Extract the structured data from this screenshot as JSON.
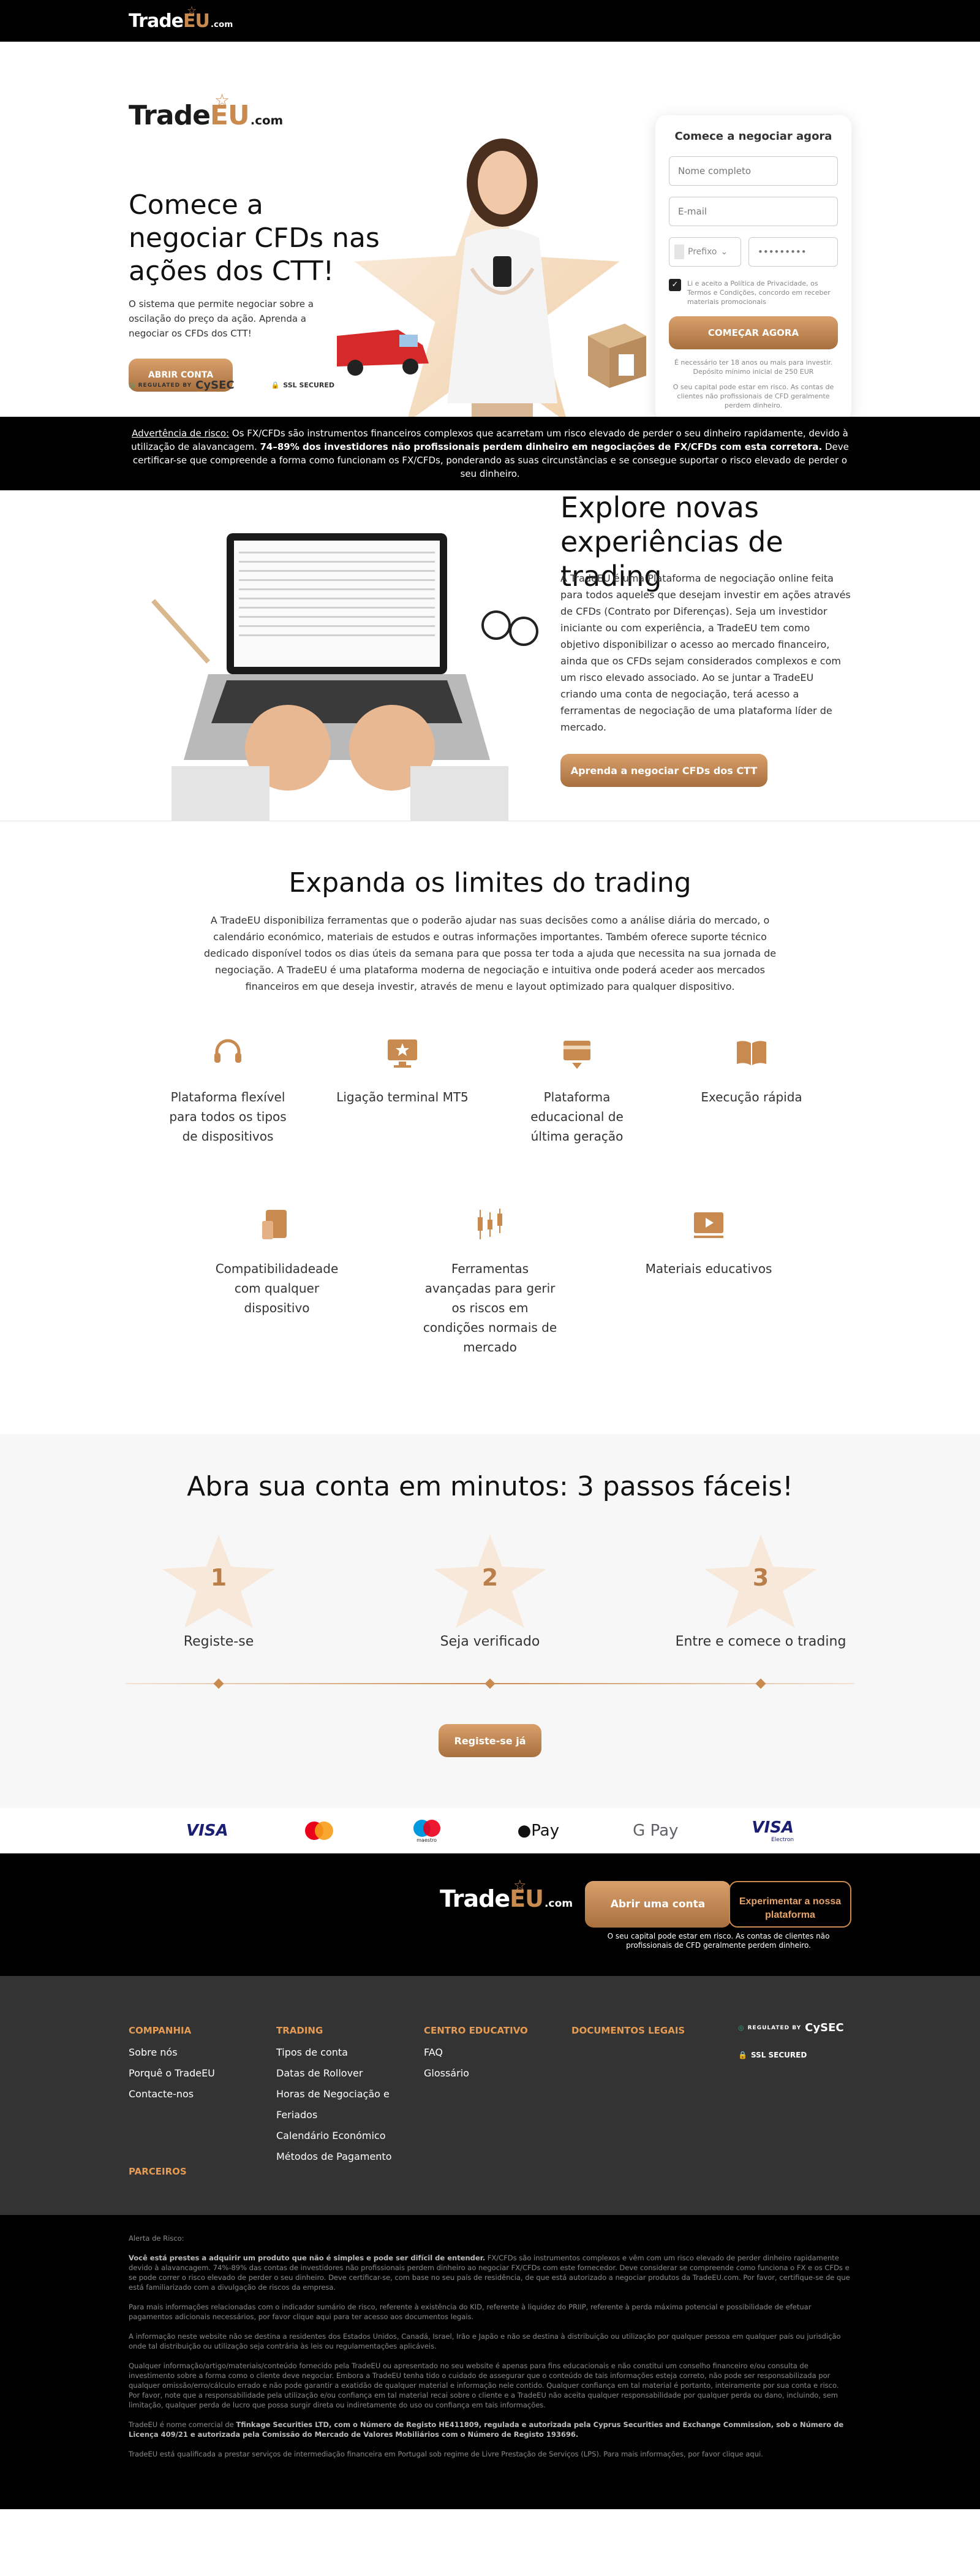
{
  "brand": {
    "name_a": "Trade",
    "name_b": "EU",
    "name_c": ".com"
  },
  "hero": {
    "title": "Comece a negociar CFDs nas ações dos CTT!",
    "description": "O sistema que permite negociar sobre a oscilação do preço da ação. Aprenda a negociar os CFDs dos CTT!",
    "cta": "ABRIR CONTA",
    "regulated": "REGULATED BY",
    "cysec": "CySEC",
    "ssl": "SSL SECURED"
  },
  "form": {
    "title": "Comece a negociar agora",
    "name_placeholder": "Nome completo",
    "email_placeholder": "E-mail",
    "prefix": "Prefixo",
    "phone_placeholder": "•••••••••",
    "consent": "Li e aceito a Política de Privacidade, os Termos e Condições, concordo em receber materiais promocionais",
    "submit": "COMEÇAR AGORA",
    "note1": "É necessário ter 18 anos ou mais para investir. Depósito mínimo inicial de 250 EUR",
    "note2": "O seu capital pode estar em risco. As contas de clientes não profissionais de CFD geralmente perdem dinheiro."
  },
  "risk": {
    "label": "Advertência de risco:",
    "text1": " Os FX/CFDs são instrumentos financeiros complexos que acarretam um risco elevado de perder o seu dinheiro rapidamente, devido à utilização de alavancagem. ",
    "bold": "74–89% dos investidores não profissionais perdem dinheiro em negociações de FX/CFDs com esta corretora.",
    "text2": " Deve certificar-se que compreende a forma como funcionam os FX/CFDs, ponderando as suas circunstâncias e se consegue suportar o risco elevado de perder o seu dinheiro."
  },
  "explore": {
    "title": "Explore novas experiências de trading",
    "description": "A TradeEU é uma Plataforma de negociação online feita para todos aqueles que desejam investir em ações através de CFDs (Contrato por Diferenças). Seja um investidor iniciante ou com experiência, a TradeEU tem como objetivo disponibilizar o acesso ao mercado financeiro, ainda que os CFDs sejam considerados complexos e com um risco elevado associado. Ao se juntar a TradeEU criando uma conta de negociação, terá acesso a ferramentas de negociação de uma plataforma líder de mercado.",
    "cta": "Aprenda a negociar CFDs dos CTT"
  },
  "expand": {
    "title": "Expanda os limites do trading",
    "description": "A TradeEU disponibiliza ferramentas que o poderão ajudar nas suas decisões como a análise diária do mercado, o calendário económico, materiais de estudos e outras informações importantes. Também oferece suporte técnico dedicado disponível todos os dias úteis da semana para que possa ter toda a ajuda que necessita na sua jornada de negociação. A TradeEU é uma plataforma moderna de negociação e intuitiva onde poderá aceder aos mercados financeiros em que deseja investir, através de menu e layout optimizado para qualquer dispositivo.",
    "features": [
      {
        "label": "Plataforma flexível para todos os tipos de dispositivos",
        "icon": "headset-icon"
      },
      {
        "label": "Ligação terminal MT5",
        "icon": "monitor-star-icon"
      },
      {
        "label": "Plataforma educacional de última geração",
        "icon": "education-icon"
      },
      {
        "label": "Execução rápida",
        "icon": "book-icon"
      },
      {
        "label": "Compatibilidadeade com qualquer dispositivo",
        "icon": "devices-icon"
      },
      {
        "label": "Ferramentas avançadas para gerir os riscos em condições normais de mercado",
        "icon": "candlestick-icon"
      },
      {
        "label": "Materiais educativos",
        "icon": "video-icon"
      }
    ]
  },
  "steps": {
    "title": "Abra sua conta em minutos: 3 passos fáceis!",
    "items": [
      {
        "num": "1",
        "label": "Registe-se"
      },
      {
        "num": "2",
        "label": "Seja verificado"
      },
      {
        "num": "3",
        "label": "Entre e comece o trading"
      }
    ],
    "cta": "Registe-se já"
  },
  "payments": {
    "visa": "VISA",
    "applepay": "Pay",
    "gpay": "G Pay",
    "visa2": "VISA",
    "electron": "Electron",
    "maestro": "maestro"
  },
  "footer_cta": {
    "btn1": "Abrir uma conta",
    "btn2": "Experimentar a nossa plataforma",
    "note": "O seu capital pode estar em risco. As contas de clientes não profissionais de CFD geralmente perdem dinheiro."
  },
  "footer": {
    "cols": [
      {
        "title": "COMPANHIA",
        "links": [
          "Sobre nós",
          "Porquê o TradeEU",
          "Contacte-nos"
        ]
      },
      {
        "title": "TRADING",
        "links": [
          "Tipos de conta",
          "Datas de Rollover",
          "Horas de Negociação e Feriados",
          "Calendário Económico",
          "Métodos de Pagamento"
        ]
      },
      {
        "title": "CENTRO EDUCATIVO",
        "links": [
          "FAQ",
          "Glossário"
        ]
      },
      {
        "title": "DOCUMENTOS LEGAIS",
        "links": []
      }
    ],
    "partners": "PARCEIROS",
    "regulated": "REGULATED BY",
    "cysec": "CySEC",
    "ssl": "SSL SECURED"
  },
  "legal": {
    "heading": "Alerta de Risco:",
    "p1_bold": "Você está prestes a adquirir um produto que não é simples e pode ser difícil de entender.",
    "p1": " FX/CFDs são instrumentos complexos e vêm com um risco elevado de perder dinheiro rapidamente devido à alavancagem. 74%-89% das contas de investidores não profissionais perdem dinheiro ao negociar FX/CFDs com este fornecedor. Deve considerar se compreende como funciona o FX e os CFDs e se pode correr o risco elevado de perder o seu dinheiro. Deve certificar-se, com base no seu país de residência, de que está autorizado a negociar produtos da TradeEU.com. Por favor, certifique-se de que está familiarizado com a divulgação de riscos da empresa.",
    "p2": "Para mais informações relacionadas com o indicador sumário de risco, referente à existência do KID, referente à liquidez do PRIIP, referente à perda máxima potencial e possibilidade de efetuar pagamentos adicionais necessários, por favor clique aqui para ter acesso aos documentos legais.",
    "p3": "A informação neste website não se destina a residentes dos Estados Unidos, Canadá, Israel, Irão e Japão e não se destina à distribuição ou utilização por qualquer pessoa em qualquer país ou jurisdição onde tal distribuição ou utilização seja contrária às leis ou regulamentações aplicáveis.",
    "p4": "Qualquer informação/artigo/materiais/conteúdo fornecido pela TradeEU ou apresentado no seu website é apenas para fins educacionais e não constitui um conselho financeiro e/ou consulta de investimento sobre a forma como o cliente deve negociar. Embora a TradeEU tenha tido o cuidado de assegurar que o conteúdo de tais informações esteja correto, não pode ser responsabilizada por qualquer omissão/erro/cálculo errado e não pode garantir a exatidão de qualquer material e informação nele contido. Qualquer confiança em tal material é portanto, inteiramente por sua conta e risco. Por favor, note que a responsabilidade pela utilização e/ou confiança em tal material recai sobre o cliente e a TradeEU não aceita qualquer responsabilidade por qualquer perda ou dano, incluindo, sem limitação, qualquer perda de lucro que possa surgir direta ou indiretamente do uso ou confiança em tais informações.",
    "p5_a": "TradeEU é nome comercial de ",
    "p5_bold": "Tfinkage Securities LTD, com o Número de Registo HE411809, regulada e autorizada pela Cyprus Securities and Exchange Commission, sob o Número de Licença 409/21 e autorizada pela Comissão do Mercado de Valores Mobiliários com o Número de Registo 193696.",
    "p6": "TradeEU está qualificada a prestar serviços de intermediação financeira em Portugal sob regime de Livre Prestação de Serviços (LPS). Para mais informações, por favor clique aqui."
  }
}
